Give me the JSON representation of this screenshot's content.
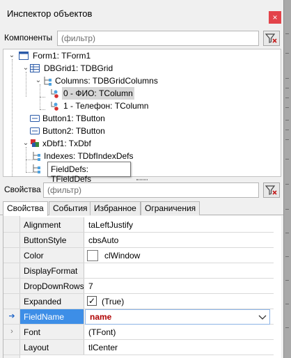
{
  "window": {
    "title": "Инспектор объектов",
    "close_glyph": "×"
  },
  "components": {
    "label": "Компоненты",
    "filter_placeholder": "(фильтр)"
  },
  "tree": {
    "items": [
      {
        "label": "Form1: TForm1",
        "icon": "form-icon"
      },
      {
        "label": "DBGrid1: TDBGrid",
        "icon": "grid-icon"
      },
      {
        "label": "Columns: TDBGridColumns",
        "icon": "collection-icon"
      },
      {
        "label": "0 - ФИО: TColumn",
        "icon": "column-icon"
      },
      {
        "label": "1 - Телефон: TColumn",
        "icon": "column-icon"
      },
      {
        "label": "Button1: TButton",
        "icon": "button-icon"
      },
      {
        "label": "Button2: TButton",
        "icon": "button-icon"
      },
      {
        "label": "xDbf1: TxDbf",
        "icon": "database-icon"
      },
      {
        "label": "Indexes: TDbfIndexDefs",
        "icon": "collection-icon"
      },
      {
        "label": "FieldDefs: TFieldDefs",
        "icon": "collection-icon"
      }
    ],
    "hint": "FieldDefs: TFieldDefs"
  },
  "properties": {
    "label": "Свойства",
    "filter_placeholder": "(фильтр)"
  },
  "tabs": [
    {
      "label": "Свойства",
      "active": true
    },
    {
      "label": "События",
      "active": false
    },
    {
      "label": "Избранное",
      "active": false
    },
    {
      "label": "Ограничения",
      "active": false
    }
  ],
  "grid": {
    "rows": [
      {
        "name": "Alignment",
        "value": "taLeftJustify"
      },
      {
        "name": "ButtonStyle",
        "value": "cbsAuto"
      },
      {
        "name": "Color",
        "value": "clWindow"
      },
      {
        "name": "DisplayFormat",
        "value": ""
      },
      {
        "name": "DropDownRows",
        "value": "7"
      },
      {
        "name": "Expanded",
        "value": "(True)"
      },
      {
        "name": "FieldName",
        "value": "name"
      },
      {
        "name": "Font",
        "value": "(TFont)"
      },
      {
        "name": "Layout",
        "value": "tlCenter"
      }
    ]
  },
  "colors": {
    "accent": "#3d8ee7",
    "close": "#e3434a",
    "edit_value": "#b00000"
  }
}
